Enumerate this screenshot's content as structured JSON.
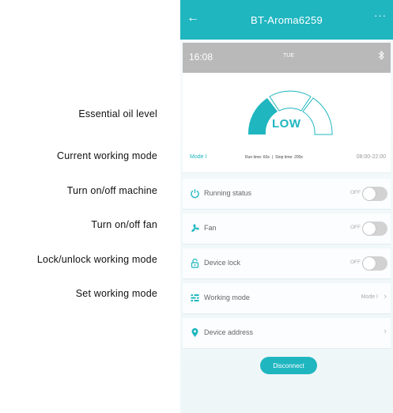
{
  "annotations": {
    "oil_level": "Essential oil level",
    "working_mode": "Current working mode",
    "machine": "Turn on/off machine",
    "fan": "Turn on/off fan",
    "lock": "Lock/unlock working mode",
    "set_mode": "Set working mode"
  },
  "app": {
    "title": "BT-Aroma6259",
    "back_icon": "arrow-left-icon",
    "more_icon": "more-dots-icon",
    "more_text": "···"
  },
  "status": {
    "time": "16:08",
    "day": "TUE",
    "bluetooth_icon": "bluetooth-icon"
  },
  "panel": {
    "level": "LOW",
    "level_fraction": 0.33,
    "mode": "Mode I",
    "run_time": "Run time: 60s",
    "separator": "|",
    "stop_time": "Stop time: 200s",
    "hours": "08:00-22:00"
  },
  "rows": {
    "running": {
      "label": "Running status",
      "state": "OFF",
      "icon": "power-icon"
    },
    "fan": {
      "label": "Fan",
      "state": "OFF",
      "icon": "fan-icon"
    },
    "lock": {
      "label": "Device lock",
      "state": "OFF",
      "icon": "lock-icon"
    },
    "mode": {
      "label": "Working mode",
      "value": "Mode I",
      "icon": "mode-icon"
    },
    "address": {
      "label": "Device address",
      "icon": "location-pin-icon"
    }
  },
  "disconnect_label": "Disconnect",
  "colors": {
    "accent": "#1fb6c0",
    "header_gray": "#b9b9b9",
    "toggle_off": "#d2d2d2"
  }
}
